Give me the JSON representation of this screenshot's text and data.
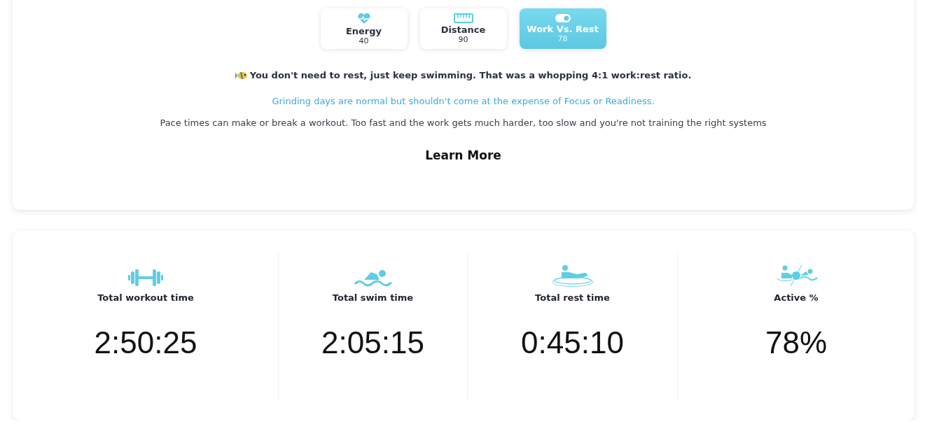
{
  "tabs": [
    {
      "kind": "heart",
      "label": "Energy",
      "value": "40",
      "selected": false
    },
    {
      "kind": "ruler",
      "label": "Distance",
      "value": "90",
      "selected": false
    },
    {
      "kind": "toggle",
      "label": "Work Vs. Rest",
      "value": "78",
      "selected": true
    }
  ],
  "message": "You don't need to rest, just keep swimming. That was a whopping 4:1 work:rest ratio.",
  "note": "Grinding days are normal but shouldn't come at the expense of Focus or Readiness.",
  "description": "Pace times can make or break a workout. Too fast and the work gets much harder, too slow and you're not training the right systems",
  "learn_more": "Learn More",
  "stats": [
    {
      "kind": "dumbbell",
      "label": "Total workout time",
      "value": "2:50:25"
    },
    {
      "kind": "swim",
      "label": "Total swim time",
      "value": "2:05:15"
    },
    {
      "kind": "rest",
      "label": "Total rest time",
      "value": "0:45:10"
    },
    {
      "kind": "versus",
      "label": "Active %",
      "value": "78%"
    }
  ]
}
